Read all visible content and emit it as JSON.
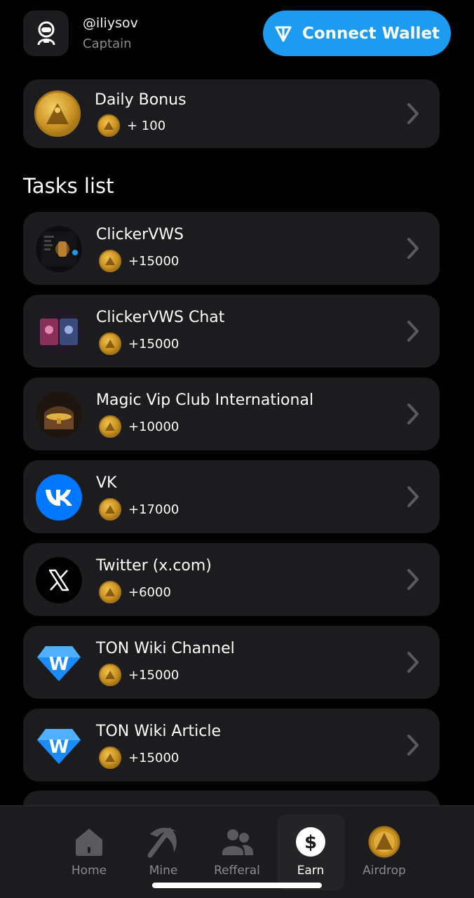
{
  "header": {
    "username": "@iliysov",
    "rank": "Captain",
    "connect_wallet_label": "Connect Wallet"
  },
  "daily_bonus": {
    "title": "Daily Bonus",
    "reward": "+ 100"
  },
  "tasks_title": "Tasks list",
  "tasks": [
    {
      "title": "ClickerVWS",
      "reward": "+15000",
      "icon": "app-screenshot-thumbnail"
    },
    {
      "title": "ClickerVWS Chat",
      "reward": "+15000",
      "icon": "cards-thumbnail"
    },
    {
      "title": "Magic Vip Club International",
      "reward": "+10000",
      "icon": "treasure-chest-thumbnail"
    },
    {
      "title": "VK",
      "reward": "+17000",
      "icon": "vk-logo-icon"
    },
    {
      "title": "Twitter (x.com)",
      "reward": "+6000",
      "icon": "x-logo-icon"
    },
    {
      "title": "TON Wiki Channel",
      "reward": "+15000",
      "icon": "ton-wiki-diamond-icon"
    },
    {
      "title": "TON Wiki Article",
      "reward": "+15000",
      "icon": "ton-wiki-diamond-icon"
    }
  ],
  "nav": {
    "items": [
      {
        "label": "Home",
        "icon": "home-icon"
      },
      {
        "label": "Mine",
        "icon": "pickaxe-icon"
      },
      {
        "label": "Refferal",
        "icon": "users-icon"
      },
      {
        "label": "Earn",
        "icon": "dollar-icon"
      },
      {
        "label": "Airdrop",
        "icon": "coin-icon"
      }
    ],
    "active": "Earn"
  },
  "colors": {
    "accent": "#1d9bf0",
    "card_bg": "#1c1c1e",
    "background": "#000000",
    "vk_blue": "#0077ff",
    "coin_gold": "#d4a03a"
  }
}
